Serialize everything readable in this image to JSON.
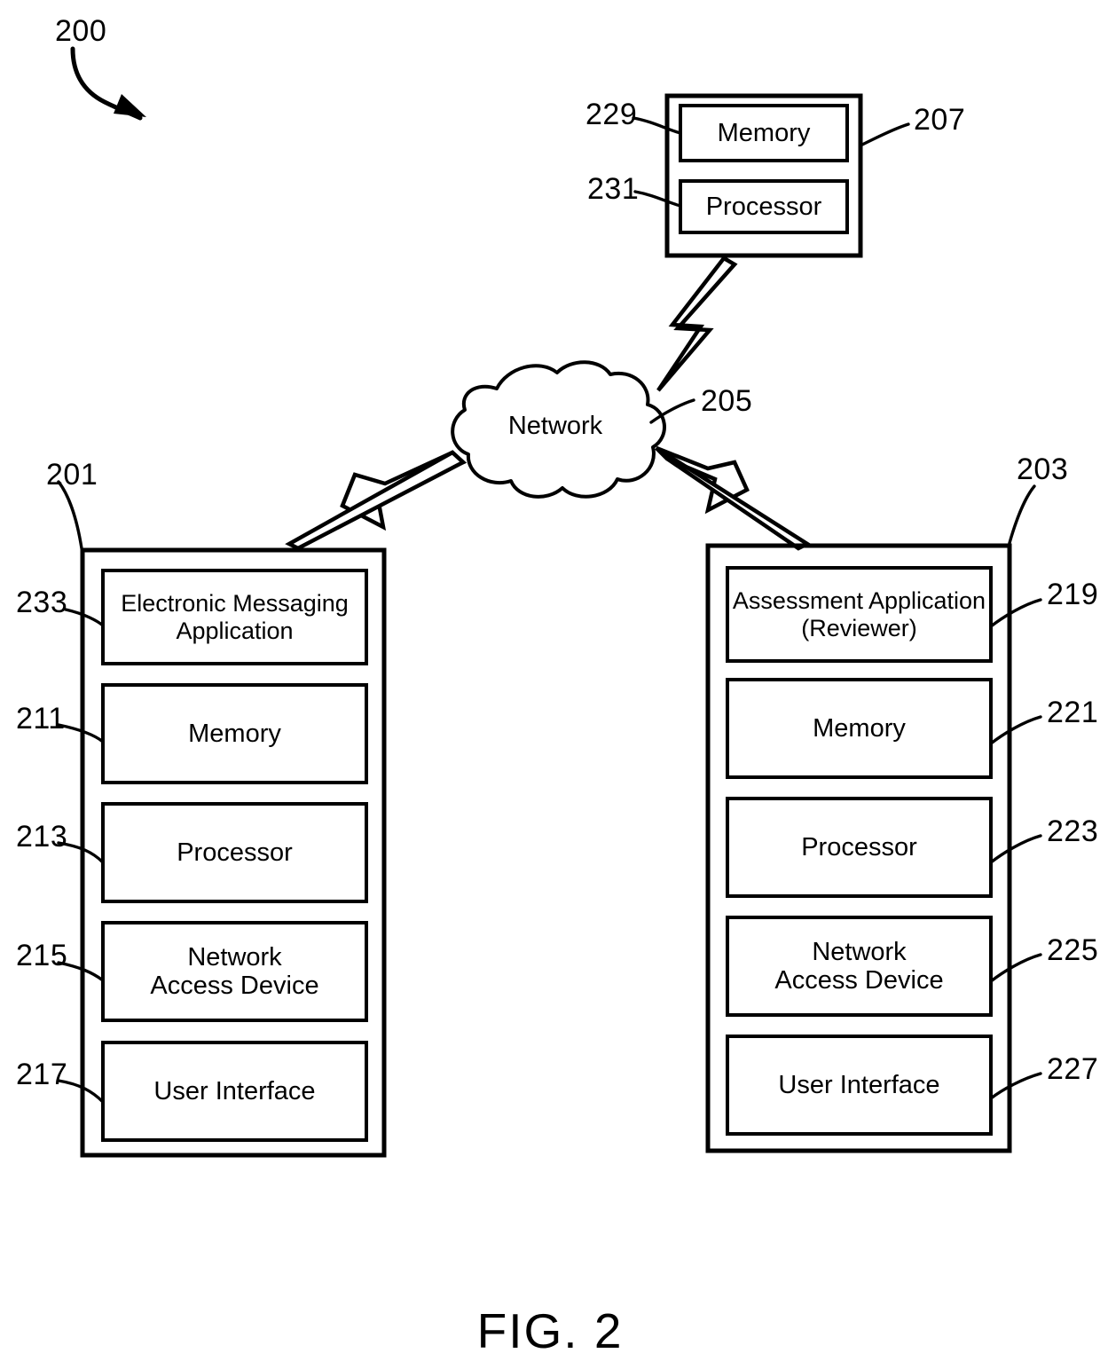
{
  "figure": {
    "caption": "FIG. 2",
    "diagram_number": "200"
  },
  "network": {
    "label": "Network",
    "ref": "205"
  },
  "server": {
    "ref": "207",
    "components": [
      {
        "label": "Memory",
        "ref": "229"
      },
      {
        "label": "Processor",
        "ref": "231"
      }
    ]
  },
  "left_device": {
    "ref": "201",
    "components": [
      {
        "label": "Electronic Messaging\nApplication",
        "line1": "Electronic Messaging",
        "line2": "Application",
        "ref": "233"
      },
      {
        "label": "Memory",
        "line1": "Memory",
        "line2": "",
        "ref": "211"
      },
      {
        "label": "Processor",
        "line1": "Processor",
        "line2": "",
        "ref": "213"
      },
      {
        "label": "Network Access Device",
        "line1": "Network",
        "line2": "Access Device",
        "ref": "215"
      },
      {
        "label": "User Interface",
        "line1": "User Interface",
        "line2": "",
        "ref": "217"
      }
    ]
  },
  "right_device": {
    "ref": "203",
    "components": [
      {
        "label": "Assessment Application (Reviewer)",
        "line1": "Assessment Application",
        "line2": "(Reviewer)",
        "ref": "219"
      },
      {
        "label": "Memory",
        "line1": "Memory",
        "line2": "",
        "ref": "221"
      },
      {
        "label": "Processor",
        "line1": "Processor",
        "line2": "",
        "ref": "223"
      },
      {
        "label": "Network Access Device",
        "line1": "Network",
        "line2": "Access Device",
        "ref": "225"
      },
      {
        "label": "User Interface",
        "line1": "User Interface",
        "line2": "",
        "ref": "227"
      }
    ]
  },
  "colors": {
    "line": "#000000",
    "background": "#ffffff"
  }
}
